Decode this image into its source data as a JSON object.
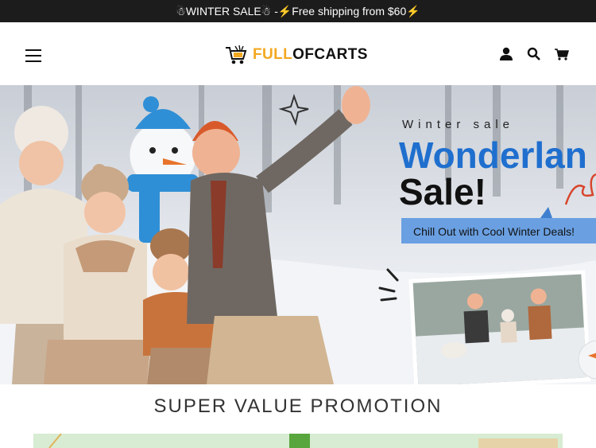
{
  "announcement": {
    "text": "☃WINTER SALE☃ -⚡Free shipping from $60⚡"
  },
  "header": {
    "logo_part1": "FULL",
    "logo_part2": "OFCARTS",
    "icons": [
      "menu-icon",
      "cart-logo-icon",
      "account-icon",
      "search-icon",
      "cart-icon"
    ]
  },
  "hero": {
    "small_text": "Winter sale",
    "headline_line1": "Wonderlan",
    "headline_line2": "Sale!",
    "button_text": "Chill Out with Cool Winter Deals!",
    "colors": {
      "headline_blue": "#1f6fce",
      "button_bg": "#3f7fd0",
      "accent_red": "#d8452c",
      "snow": "#f2f4f7"
    }
  },
  "promotion": {
    "title": "SUPER VALUE PROMOTION"
  }
}
